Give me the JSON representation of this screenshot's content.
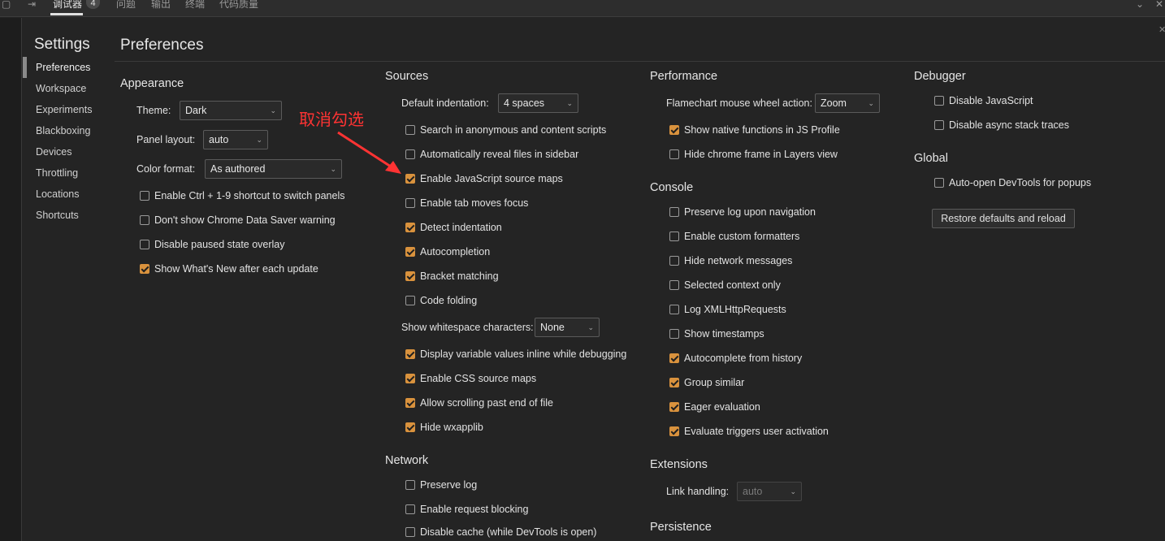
{
  "topbar": {
    "tabs": [
      "调试器",
      "问题",
      "输出",
      "终端",
      "代码质量"
    ],
    "badge": "4",
    "dock_icon": "⇥",
    "chevron_icon": "⌄",
    "close_icon": "✕"
  },
  "sidebar": {
    "title": "Settings",
    "items": [
      "Preferences",
      "Workspace",
      "Experiments",
      "Blackboxing",
      "Devices",
      "Throttling",
      "Locations",
      "Shortcuts"
    ]
  },
  "page_title": "Preferences",
  "annotation": "取消勾选",
  "appearance": {
    "title": "Appearance",
    "theme_label": "Theme:",
    "theme_value": "Dark",
    "panel_layout_label": "Panel layout:",
    "panel_layout_value": "auto",
    "color_format_label": "Color format:",
    "color_format_value": "As authored",
    "checkboxes": [
      {
        "label": "Enable Ctrl + 1-9 shortcut to switch panels",
        "checked": false
      },
      {
        "label": "Don't show Chrome Data Saver warning",
        "checked": false
      },
      {
        "label": "Disable paused state overlay",
        "checked": false
      },
      {
        "label": "Show What's New after each update",
        "checked": true
      }
    ]
  },
  "sources": {
    "title": "Sources",
    "indent_label": "Default indentation:",
    "indent_value": "4 spaces",
    "checkboxes_a": [
      {
        "label": "Search in anonymous and content scripts",
        "checked": false
      },
      {
        "label": "Automatically reveal files in sidebar",
        "checked": false
      },
      {
        "label": "Enable JavaScript source maps",
        "checked": true
      },
      {
        "label": "Enable tab moves focus",
        "checked": false
      },
      {
        "label": "Detect indentation",
        "checked": true
      },
      {
        "label": "Autocompletion",
        "checked": true
      },
      {
        "label": "Bracket matching",
        "checked": true
      },
      {
        "label": "Code folding",
        "checked": false
      }
    ],
    "whitespace_label": "Show whitespace characters:",
    "whitespace_value": "None",
    "checkboxes_b": [
      {
        "label": "Display variable values inline while debugging",
        "checked": true
      },
      {
        "label": "Enable CSS source maps",
        "checked": true
      },
      {
        "label": "Allow scrolling past end of file",
        "checked": true
      },
      {
        "label": "Hide wxapplib",
        "checked": true
      }
    ]
  },
  "network": {
    "title": "Network",
    "checkboxes": [
      {
        "label": "Preserve log",
        "checked": false
      },
      {
        "label": "Enable request blocking",
        "checked": false
      },
      {
        "label": "Disable cache (while DevTools is open)",
        "checked": false
      }
    ]
  },
  "performance": {
    "title": "Performance",
    "flame_label": "Flamechart mouse wheel action:",
    "flame_value": "Zoom",
    "checkboxes": [
      {
        "label": "Show native functions in JS Profile",
        "checked": true
      },
      {
        "label": "Hide chrome frame in Layers view",
        "checked": false
      }
    ]
  },
  "console": {
    "title": "Console",
    "checkboxes": [
      {
        "label": "Preserve log upon navigation",
        "checked": false
      },
      {
        "label": "Enable custom formatters",
        "checked": false
      },
      {
        "label": "Hide network messages",
        "checked": false
      },
      {
        "label": "Selected context only",
        "checked": false
      },
      {
        "label": "Log XMLHttpRequests",
        "checked": false
      },
      {
        "label": "Show timestamps",
        "checked": false
      },
      {
        "label": "Autocomplete from history",
        "checked": true
      },
      {
        "label": "Group similar",
        "checked": true
      },
      {
        "label": "Eager evaluation",
        "checked": true
      },
      {
        "label": "Evaluate triggers user activation",
        "checked": true
      }
    ]
  },
  "extensions": {
    "title": "Extensions",
    "link_label": "Link handling:",
    "link_value": "auto"
  },
  "persistence": {
    "title": "Persistence"
  },
  "debugger": {
    "title": "Debugger",
    "checkboxes": [
      {
        "label": "Disable JavaScript",
        "checked": false
      },
      {
        "label": "Disable async stack traces",
        "checked": false
      }
    ]
  },
  "global": {
    "title": "Global",
    "checkboxes": [
      {
        "label": "Auto-open DevTools for popups",
        "checked": false
      }
    ],
    "restore_button": "Restore defaults and reload"
  },
  "colors": {
    "accent": "#d9923d",
    "annotation": "#ff3333",
    "background": "#242424"
  }
}
